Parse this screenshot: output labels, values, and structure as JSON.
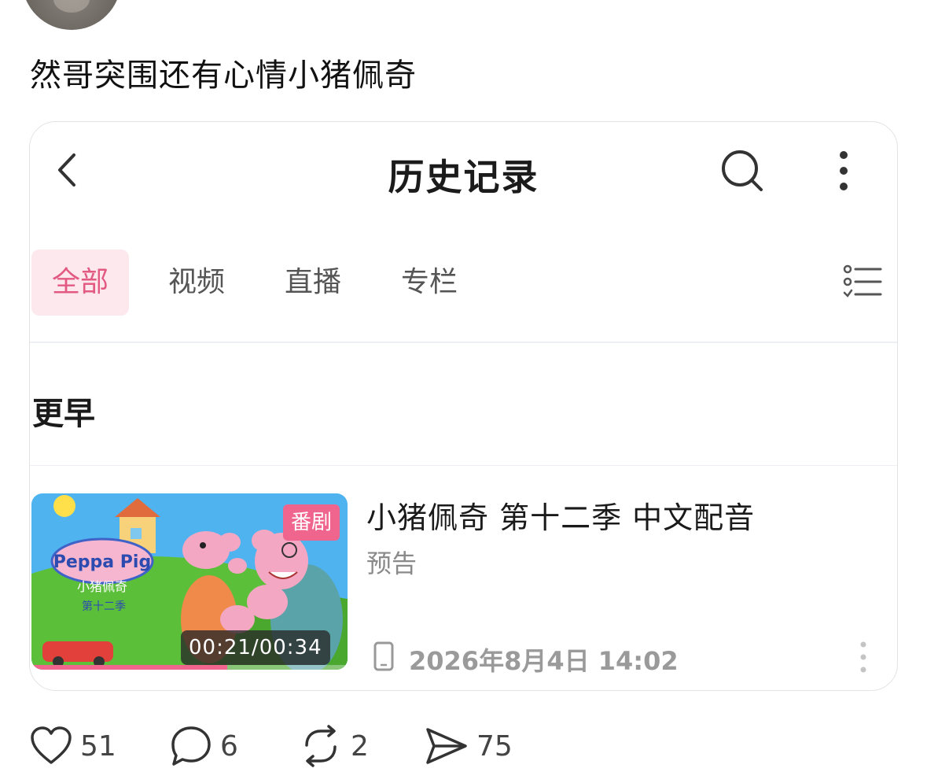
{
  "post": {
    "text": "然哥突围还有心情小猪佩奇"
  },
  "screenshot": {
    "nav": {
      "title": "历史记录"
    },
    "tabs": [
      {
        "label": "全部",
        "active": true
      },
      {
        "label": "视频",
        "active": false
      },
      {
        "label": "直播",
        "active": false
      },
      {
        "label": "专栏",
        "active": false
      }
    ],
    "section_label": "更早",
    "item": {
      "title": "小猪佩奇 第十二季 中文配音",
      "subtitle": "预告",
      "badge": "番剧",
      "duration": "00:21/00:34",
      "progress_fraction": 0.62,
      "watched_at": "2026年8月4日 14:02",
      "device_icon": "phone-icon",
      "thumbnail_logo_text": "Peppa Pig",
      "thumbnail_cn_text": "小猪佩奇",
      "thumbnail_season_text": "第十二季"
    },
    "accent_color": "#f0658e"
  },
  "actions": {
    "likes": "51",
    "replies": "6",
    "reposts": "2",
    "shares": "75"
  }
}
